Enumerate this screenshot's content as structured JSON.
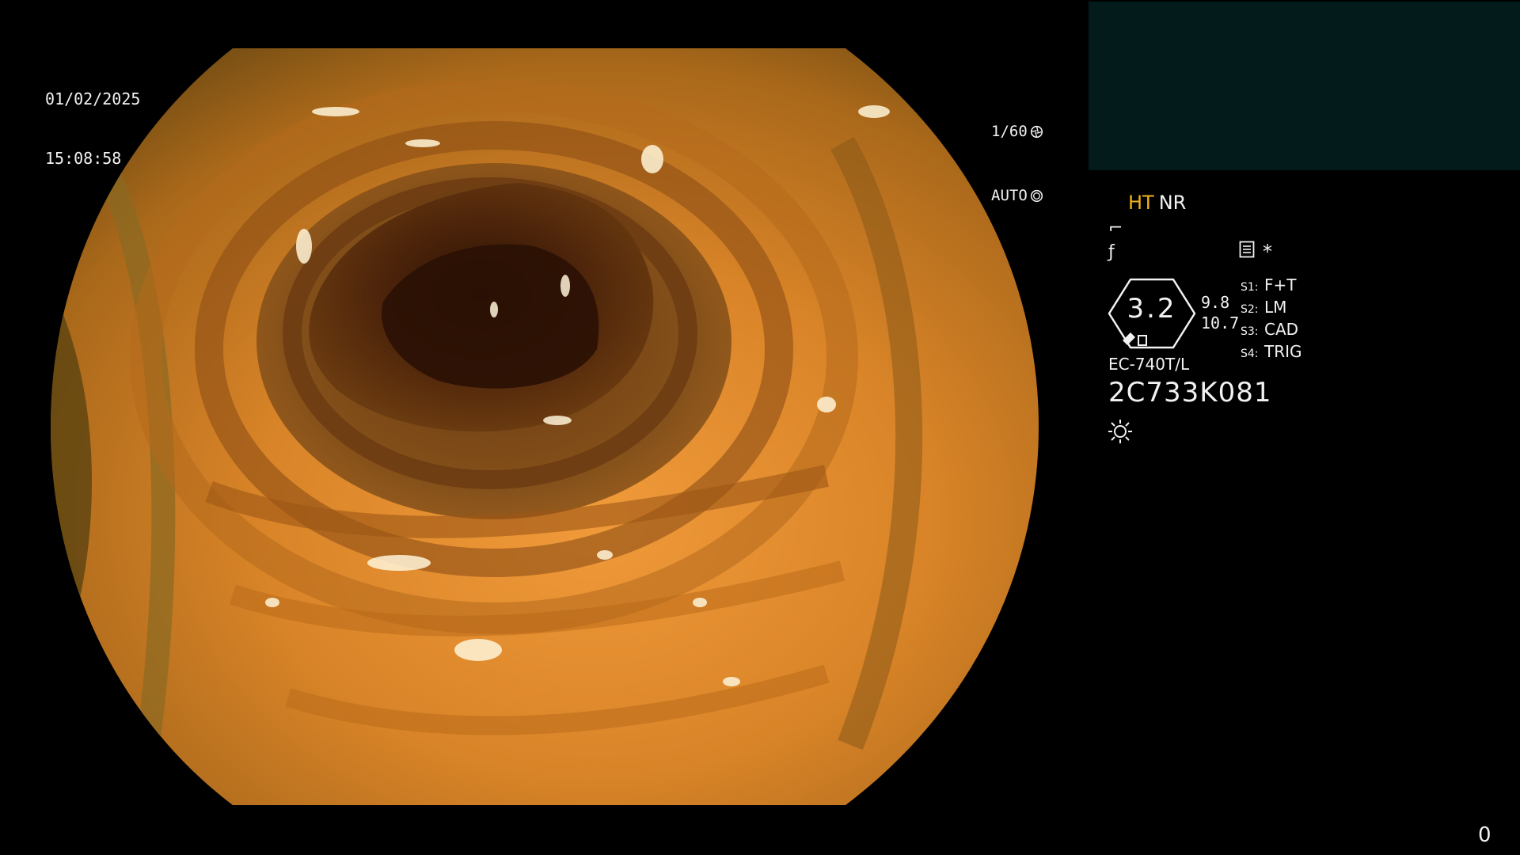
{
  "overlay": {
    "date": "01/02/2025",
    "time": "15:08:58",
    "shutter_speed": "1/60",
    "iris_mode": "AUTO",
    "shutter_icon": "aperture-icon",
    "iris_icon": "iris-icon"
  },
  "info_panel": {
    "mode_ht": "HT",
    "mode_nr": "NR",
    "mode_ht_color": "#f0b418",
    "curve_icon": "contrast-curve-icon",
    "f_icon": "f-enhance-icon",
    "memo_icon": "memo-icon",
    "star": "*",
    "zoom_value": "3.2",
    "zoom_a": "9.8",
    "zoom_b": "10.7",
    "switches": [
      {
        "key": "S1:",
        "value": "F+T"
      },
      {
        "key": "S2:",
        "value": "LM"
      },
      {
        "key": "S3:",
        "value": "CAD"
      },
      {
        "key": "S4:",
        "value": "TRIG"
      }
    ],
    "scope_model": "EC-740T/L",
    "serial_number": "2C733K081",
    "light_icon": "light-source-icon"
  },
  "frame_counter": "0",
  "colors": {
    "background": "#000000",
    "thumbnail_panel": "#031b1b",
    "mucosa_base": "#c8781e",
    "lumen": "#3a1a06"
  }
}
